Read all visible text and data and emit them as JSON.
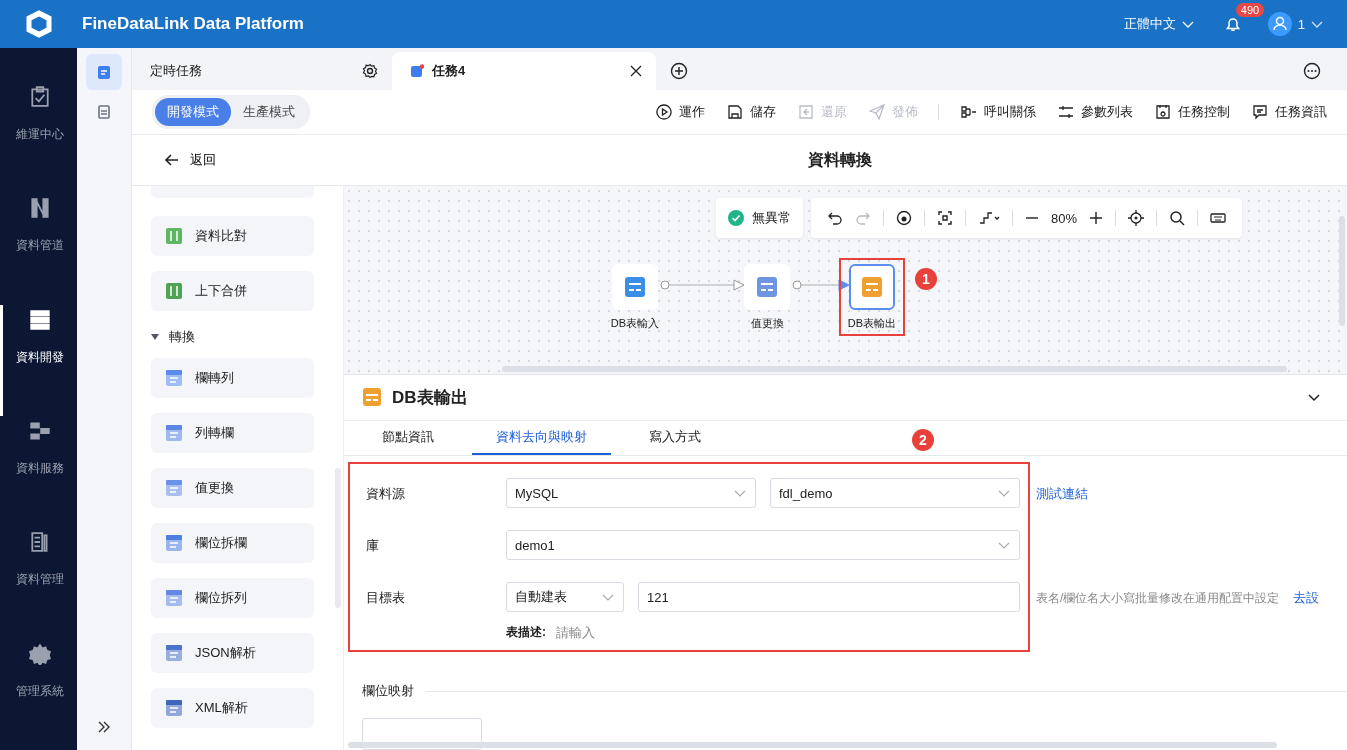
{
  "app": {
    "title": "FineDataLink Data Platform",
    "language": "正體中文",
    "notifications": "490",
    "user": "1"
  },
  "nav": [
    {
      "label": "維運中心",
      "kind": "ops",
      "selected": false
    },
    {
      "label": "資料管道",
      "kind": "pipe",
      "selected": false
    },
    {
      "label": "資料開發",
      "kind": "dev",
      "selected": true
    },
    {
      "label": "資料服務",
      "kind": "service",
      "selected": false
    },
    {
      "label": "資料管理",
      "kind": "manage",
      "selected": false
    },
    {
      "label": "管理系統",
      "kind": "system",
      "selected": false
    }
  ],
  "side_tools": [
    {
      "kind": "task",
      "selected": true
    },
    {
      "kind": "clip",
      "selected": false
    }
  ],
  "tabs": [
    {
      "label": "定時任務",
      "selected": false
    },
    {
      "label": "任務4",
      "selected": true
    }
  ],
  "modes": [
    {
      "label": "開發模式",
      "selected": true
    },
    {
      "label": "生產模式",
      "selected": false
    }
  ],
  "actions": [
    {
      "label": "運作",
      "kind": "run",
      "disabled": false
    },
    {
      "label": "儲存",
      "kind": "save",
      "disabled": false
    },
    {
      "label": "還原",
      "kind": "revert",
      "disabled": true
    },
    {
      "label": "發佈",
      "kind": "publish",
      "disabled": true
    },
    {
      "label": "呼叫關係",
      "kind": "relation",
      "disabled": false
    },
    {
      "label": "參數列表",
      "kind": "params",
      "disabled": false
    },
    {
      "label": "任務控制",
      "kind": "control",
      "disabled": false
    },
    {
      "label": "任務資訊",
      "kind": "info",
      "disabled": false
    }
  ],
  "back": "返回",
  "page_title": "資料轉換",
  "palette": {
    "items": [
      {
        "label": "資料比對",
        "kind": "compare"
      },
      {
        "label": "上下合併",
        "kind": "merge"
      }
    ],
    "group": {
      "label": "轉換",
      "expanded": true,
      "items": [
        {
          "label": "欄轉列",
          "kind": "col2row"
        },
        {
          "label": "列轉欄",
          "kind": "row2col"
        },
        {
          "label": "值更換",
          "kind": "replace"
        },
        {
          "label": "欄位拆欄",
          "kind": "splitcol"
        },
        {
          "label": "欄位拆列",
          "kind": "splitrow"
        },
        {
          "label": "JSON解析",
          "kind": "json"
        },
        {
          "label": "XML解析",
          "kind": "xml"
        }
      ]
    }
  },
  "canvas": {
    "status": "無異常",
    "zoom": "80%",
    "nodes": [
      {
        "label": "DB表輸入",
        "kind": "input",
        "selected": false
      },
      {
        "label": "值更換",
        "kind": "replace",
        "selected": false
      },
      {
        "label": "DB表輸出",
        "kind": "output",
        "selected": true,
        "callout": "1"
      }
    ]
  },
  "panel": {
    "title": "DB表輸出",
    "callout": "2",
    "tabs": [
      {
        "label": "節點資訊",
        "selected": false
      },
      {
        "label": "資料去向與映射",
        "selected": true
      },
      {
        "label": "寫入方式",
        "selected": false
      }
    ],
    "source_label": "資料源",
    "source_type": "MySQL",
    "connection": "fdl_demo",
    "test_link": "測試連結",
    "db_label": "庫",
    "db": "demo1",
    "target_label": "目標表",
    "target_mode": "自動建表",
    "target_table": "121",
    "target_hint": "表名/欄位名大小寫批量修改在通用配置中設定",
    "target_link": "去設",
    "desc_label": "表描述:",
    "desc_placeholder": "請輸入",
    "section": "欄位映射"
  }
}
